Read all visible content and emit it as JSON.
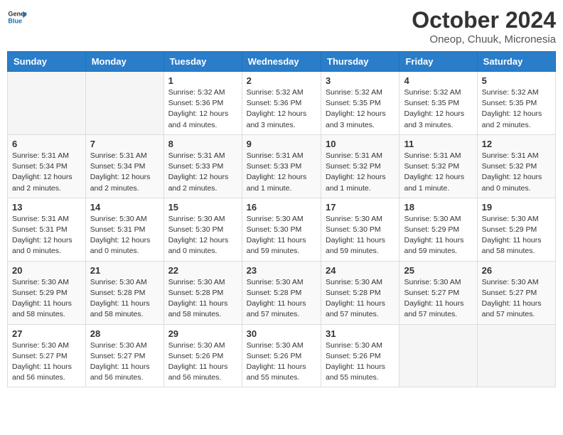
{
  "header": {
    "logo_line1": "General",
    "logo_line2": "Blue",
    "month": "October 2024",
    "location": "Oneop, Chuuk, Micronesia"
  },
  "weekdays": [
    "Sunday",
    "Monday",
    "Tuesday",
    "Wednesday",
    "Thursday",
    "Friday",
    "Saturday"
  ],
  "weeks": [
    [
      {
        "day": "",
        "info": ""
      },
      {
        "day": "",
        "info": ""
      },
      {
        "day": "1",
        "info": "Sunrise: 5:32 AM\nSunset: 5:36 PM\nDaylight: 12 hours and 4 minutes."
      },
      {
        "day": "2",
        "info": "Sunrise: 5:32 AM\nSunset: 5:36 PM\nDaylight: 12 hours and 3 minutes."
      },
      {
        "day": "3",
        "info": "Sunrise: 5:32 AM\nSunset: 5:35 PM\nDaylight: 12 hours and 3 minutes."
      },
      {
        "day": "4",
        "info": "Sunrise: 5:32 AM\nSunset: 5:35 PM\nDaylight: 12 hours and 3 minutes."
      },
      {
        "day": "5",
        "info": "Sunrise: 5:32 AM\nSunset: 5:35 PM\nDaylight: 12 hours and 2 minutes."
      }
    ],
    [
      {
        "day": "6",
        "info": "Sunrise: 5:31 AM\nSunset: 5:34 PM\nDaylight: 12 hours and 2 minutes."
      },
      {
        "day": "7",
        "info": "Sunrise: 5:31 AM\nSunset: 5:34 PM\nDaylight: 12 hours and 2 minutes."
      },
      {
        "day": "8",
        "info": "Sunrise: 5:31 AM\nSunset: 5:33 PM\nDaylight: 12 hours and 2 minutes."
      },
      {
        "day": "9",
        "info": "Sunrise: 5:31 AM\nSunset: 5:33 PM\nDaylight: 12 hours and 1 minute."
      },
      {
        "day": "10",
        "info": "Sunrise: 5:31 AM\nSunset: 5:32 PM\nDaylight: 12 hours and 1 minute."
      },
      {
        "day": "11",
        "info": "Sunrise: 5:31 AM\nSunset: 5:32 PM\nDaylight: 12 hours and 1 minute."
      },
      {
        "day": "12",
        "info": "Sunrise: 5:31 AM\nSunset: 5:32 PM\nDaylight: 12 hours and 0 minutes."
      }
    ],
    [
      {
        "day": "13",
        "info": "Sunrise: 5:31 AM\nSunset: 5:31 PM\nDaylight: 12 hours and 0 minutes."
      },
      {
        "day": "14",
        "info": "Sunrise: 5:30 AM\nSunset: 5:31 PM\nDaylight: 12 hours and 0 minutes."
      },
      {
        "day": "15",
        "info": "Sunrise: 5:30 AM\nSunset: 5:30 PM\nDaylight: 12 hours and 0 minutes."
      },
      {
        "day": "16",
        "info": "Sunrise: 5:30 AM\nSunset: 5:30 PM\nDaylight: 11 hours and 59 minutes."
      },
      {
        "day": "17",
        "info": "Sunrise: 5:30 AM\nSunset: 5:30 PM\nDaylight: 11 hours and 59 minutes."
      },
      {
        "day": "18",
        "info": "Sunrise: 5:30 AM\nSunset: 5:29 PM\nDaylight: 11 hours and 59 minutes."
      },
      {
        "day": "19",
        "info": "Sunrise: 5:30 AM\nSunset: 5:29 PM\nDaylight: 11 hours and 58 minutes."
      }
    ],
    [
      {
        "day": "20",
        "info": "Sunrise: 5:30 AM\nSunset: 5:29 PM\nDaylight: 11 hours and 58 minutes."
      },
      {
        "day": "21",
        "info": "Sunrise: 5:30 AM\nSunset: 5:28 PM\nDaylight: 11 hours and 58 minutes."
      },
      {
        "day": "22",
        "info": "Sunrise: 5:30 AM\nSunset: 5:28 PM\nDaylight: 11 hours and 58 minutes."
      },
      {
        "day": "23",
        "info": "Sunrise: 5:30 AM\nSunset: 5:28 PM\nDaylight: 11 hours and 57 minutes."
      },
      {
        "day": "24",
        "info": "Sunrise: 5:30 AM\nSunset: 5:28 PM\nDaylight: 11 hours and 57 minutes."
      },
      {
        "day": "25",
        "info": "Sunrise: 5:30 AM\nSunset: 5:27 PM\nDaylight: 11 hours and 57 minutes."
      },
      {
        "day": "26",
        "info": "Sunrise: 5:30 AM\nSunset: 5:27 PM\nDaylight: 11 hours and 57 minutes."
      }
    ],
    [
      {
        "day": "27",
        "info": "Sunrise: 5:30 AM\nSunset: 5:27 PM\nDaylight: 11 hours and 56 minutes."
      },
      {
        "day": "28",
        "info": "Sunrise: 5:30 AM\nSunset: 5:27 PM\nDaylight: 11 hours and 56 minutes."
      },
      {
        "day": "29",
        "info": "Sunrise: 5:30 AM\nSunset: 5:26 PM\nDaylight: 11 hours and 56 minutes."
      },
      {
        "day": "30",
        "info": "Sunrise: 5:30 AM\nSunset: 5:26 PM\nDaylight: 11 hours and 55 minutes."
      },
      {
        "day": "31",
        "info": "Sunrise: 5:30 AM\nSunset: 5:26 PM\nDaylight: 11 hours and 55 minutes."
      },
      {
        "day": "",
        "info": ""
      },
      {
        "day": "",
        "info": ""
      }
    ]
  ]
}
